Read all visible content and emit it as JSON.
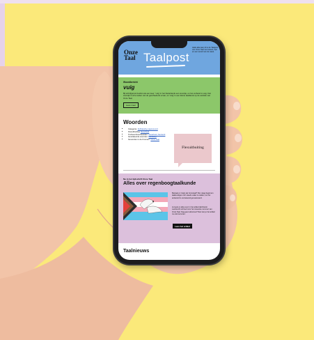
{
  "newsletter": {
    "logo_line1": "Onze",
    "logo_line2": "Taal",
    "title": "Taalpost",
    "header_side_text": "Hallo allemaal, dit is de Taalpost van Onze Taal met nieuws, tips en een woord van de week."
  },
  "woordbericht": {
    "label": "Woordbericht",
    "word": "vuig",
    "text": "Bij schrijfgeruis beslist ook een keer: 'vuig' in het Nederlands een woordje; en het verband is vuig. Dat woordje is af te leiden van de geschiedenis ervan; en 'vuig' is een kleine taaldienst op de website van Onze Taal.",
    "button": "Lees meer"
  },
  "woorden": {
    "title": "Woorden",
    "items": [
      {
        "label": "Categorie:",
        "link": "Zelfstandig naamwoord"
      },
      {
        "label": "Flexuitbuiting:",
        "link": "flexarbeid"
      },
      {
        "label": "Trefwoordvoorbeelden:",
        "link": "flexarbeid, flexwerk"
      },
      {
        "label": "Gerelateerde woorden:",
        "link": "uitbuiting"
      },
      {
        "label": "Gevonden in de bronnen:",
        "link": "Onze Taal"
      }
    ],
    "bubble_word": "Flexuitbuiting"
  },
  "artikel": {
    "label": "Nu in het tijdschrift Onze Taal",
    "title": "Alles over regenboogtaalkunde",
    "text1": "Bestaat er zoiets als homotaal? Die vraag beginnen taalkundigen zich steeds vaker te stellen; en het antwoord is verrassend genuanceerd.",
    "text2": "Je leest er alles over in het artikel dat Ramin Lambrecht schreef voor het nieuwste nummer van Onze Taal. Nog geen abonnee? Dan kun je het artikel nu ook los lezen.",
    "button": "Lees het artikel"
  },
  "taalnieuws": {
    "title": "Taalnieuws"
  },
  "colors": {
    "background": "#fbe97a",
    "header": "#6fa6df",
    "green_block": "#8cc76a",
    "pink_block": "#dcc0dc",
    "bubble": "#ebc8cc"
  }
}
